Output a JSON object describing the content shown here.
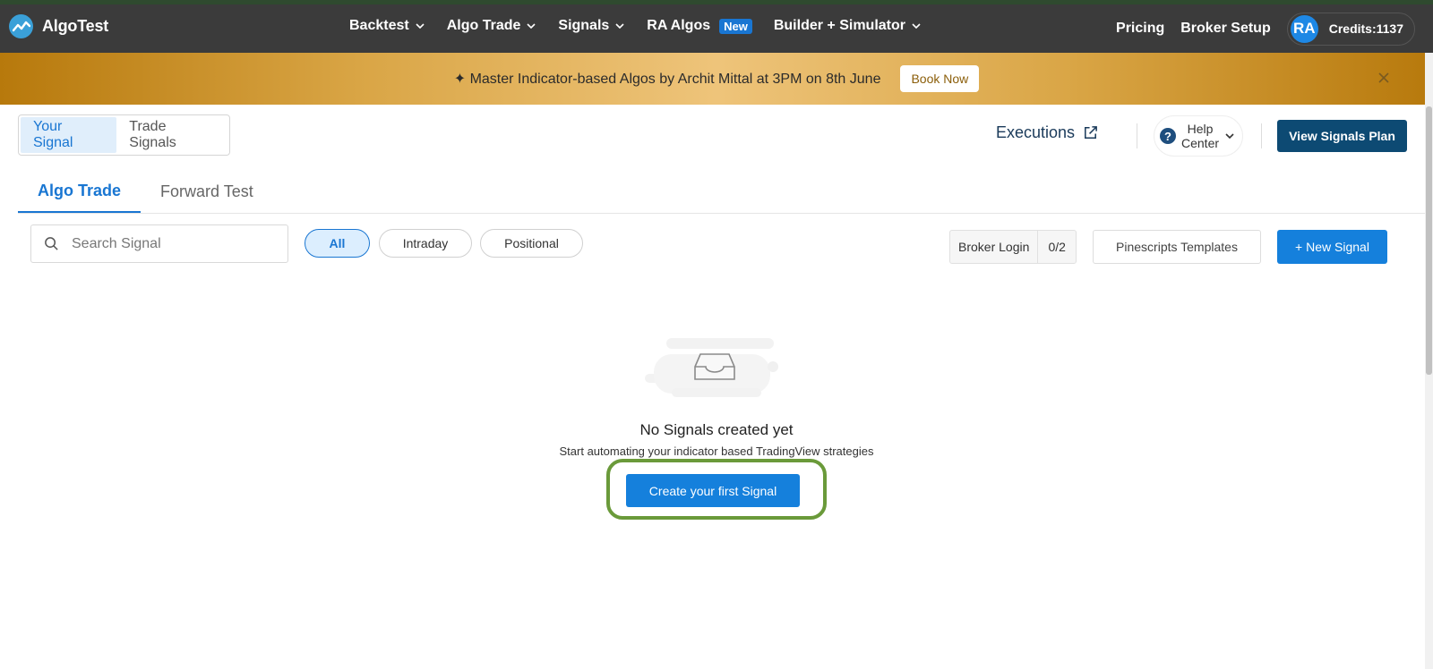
{
  "navbar": {
    "brand": "AlgoTest",
    "items": [
      {
        "label": "Backtest",
        "dropdown": true
      },
      {
        "label": "Algo Trade",
        "dropdown": true
      },
      {
        "label": "Signals",
        "dropdown": true
      },
      {
        "label": "RA Algos",
        "badge": "New"
      },
      {
        "label": "Builder + Simulator",
        "dropdown": true
      }
    ],
    "pricing": "Pricing",
    "broker_setup": "Broker Setup",
    "avatar_initials": "RA",
    "credits": "Credits:1137"
  },
  "banner": {
    "icon": "sparkle-icon",
    "text": "✦  Master Indicator-based Algos by Archit Mittal at 3PM on 8th June",
    "button": "Book Now"
  },
  "signal_toggle": {
    "options": [
      "Your Signal",
      "Trade Signals"
    ],
    "active": "Your Signal"
  },
  "header_actions": {
    "executions": "Executions",
    "help_center_line1": "Help",
    "help_center_line2": "Center",
    "view_plan": "View Signals Plan"
  },
  "tabs": {
    "items": [
      "Algo Trade",
      "Forward Test"
    ],
    "active": "Algo Trade"
  },
  "filters": {
    "search_placeholder": "Search Signal",
    "chips": [
      "All",
      "Intraday",
      "Positional"
    ],
    "active_chip": "All"
  },
  "actions": {
    "broker_login": "Broker Login",
    "broker_count": "0/2",
    "pinescripts": "Pinescripts Templates",
    "new_signal": "+  New Signal"
  },
  "empty_state": {
    "title": "No Signals created yet",
    "subtitle": "Start automating your indicator based TradingView strategies",
    "button": "Create your first Signal"
  },
  "colors": {
    "navbar": "#3b3b3b",
    "primary": "#1580dc",
    "dark_blue": "#0d4a73",
    "highlight": "#6a9a3a"
  }
}
